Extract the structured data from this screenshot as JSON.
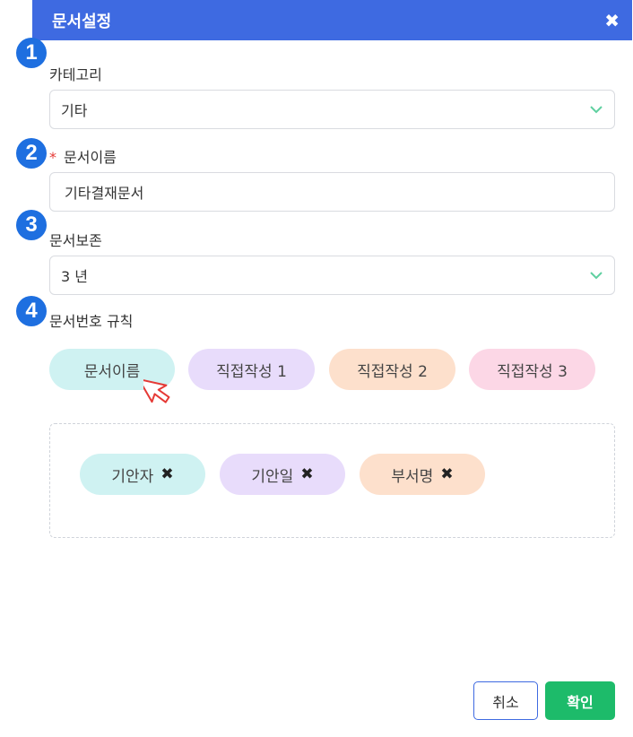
{
  "dialog": {
    "title": "문서설정",
    "close_symbol": "✖"
  },
  "steps": [
    "1",
    "2",
    "3",
    "4"
  ],
  "category": {
    "label": "카테고리",
    "value": "기타"
  },
  "doc_name": {
    "required_mark": "*",
    "label": "문서이름",
    "value": "기타결재문서"
  },
  "retention": {
    "label": "문서보존",
    "value": "3 년"
  },
  "numbering": {
    "label": "문서번호 규칙",
    "chips": [
      "문서이름",
      "직접작성 1",
      "직접작성 2",
      "직접작성 3"
    ],
    "selected": [
      "기안자",
      "기안일",
      "부서명"
    ],
    "remove_symbol": "✖"
  },
  "actions": {
    "cancel": "취소",
    "confirm": "확인"
  },
  "colors": {
    "header": "#3e6ae1",
    "step_badge": "#1e6fe0",
    "confirm": "#1dbb6a",
    "chip_cyan": "#cff2f2",
    "chip_purple": "#e8dcfb",
    "chip_orange": "#fde0cc",
    "chip_pink": "#fcd7e6",
    "chevron": "#5fd0a0"
  }
}
